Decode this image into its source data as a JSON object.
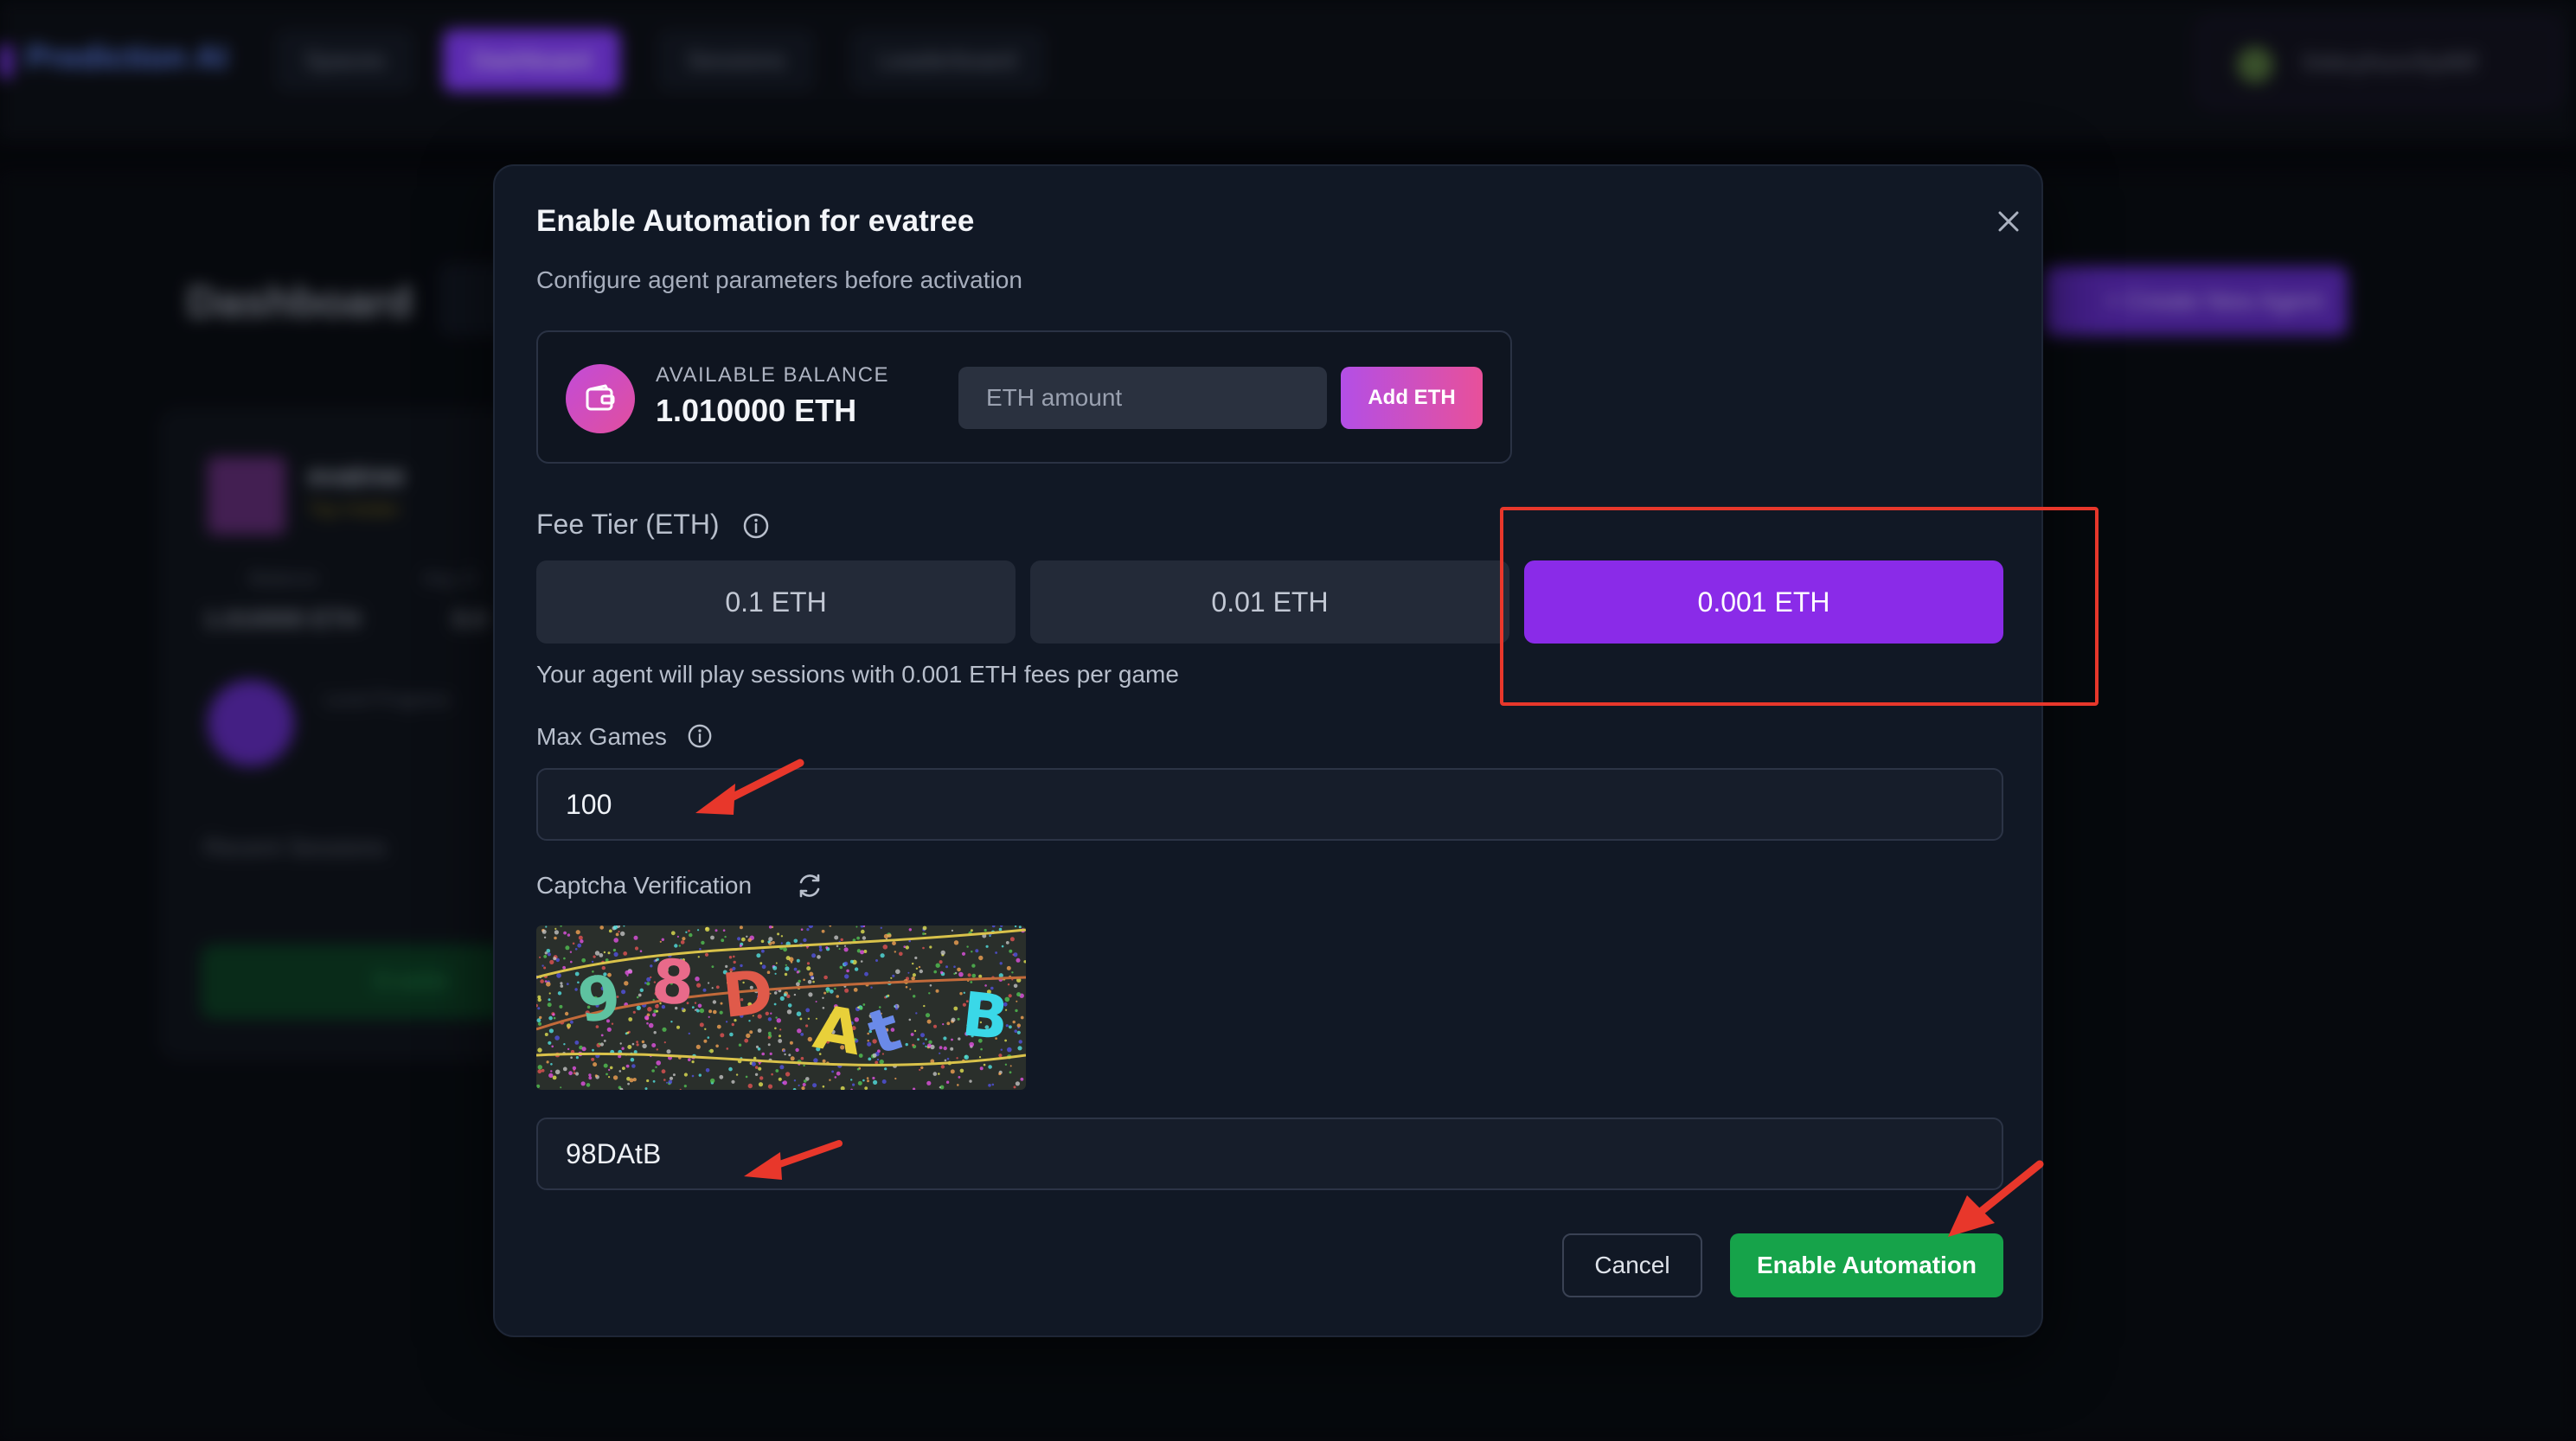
{
  "background": {
    "brand": "Prediction AI",
    "nav_tabs": [
      "Spaces",
      "Dashboard",
      "Sessions",
      "Leaderboard"
    ],
    "user_label": "0xbcyhuvv5y66f",
    "page_title": "Dashboard",
    "create_button": "+ Create New Agent",
    "agent_card": {
      "name": "evatree",
      "badge": "Top Holder",
      "balance_label": "Balance",
      "balance_value": "1.010000 ETH",
      "avg_label": "Avg. E",
      "avg_value": "0.0",
      "level_label": "Level Progress",
      "recent_sessions": "Recent Sessions",
      "enable_button": "Enable"
    }
  },
  "modal": {
    "title": "Enable Automation for evatree",
    "subtitle": "Configure agent parameters before activation",
    "balance": {
      "label": "AVAILABLE BALANCE",
      "value": "1.010000 ETH",
      "input_placeholder": "ETH amount",
      "add_button": "Add ETH"
    },
    "fee_tier": {
      "label": "Fee Tier (ETH)",
      "options": [
        "0.1 ETH",
        "0.01 ETH",
        "0.001 ETH"
      ],
      "selected_index": 2,
      "description": "Your agent will play sessions with 0.001 ETH fees per game"
    },
    "max_games": {
      "label": "Max Games",
      "value": "100"
    },
    "captcha": {
      "label": "Captcha Verification",
      "image_text": "98DAtB",
      "input_value": "98DAtB"
    },
    "buttons": {
      "cancel": "Cancel",
      "enable": "Enable Automation"
    }
  },
  "colors": {
    "accent_purple": "#8a2be8",
    "success_green": "#16a34a",
    "annotation_red": "#e8372b"
  }
}
